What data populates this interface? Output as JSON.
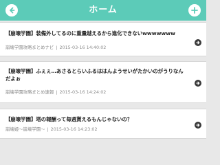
{
  "header": {
    "title": "ホーム",
    "back_icon": "arrow-left-icon",
    "add_icon": "plus-icon",
    "accent_color": "#5ccbb8"
  },
  "items": [
    {
      "title": "【崩壊学園】装備外してるのに重量越えるから進化できないwwwwwww",
      "source": "崩壊学園攻略まとめナビ",
      "separator": "|",
      "date": "2015-03-16 14:40:02"
    },
    {
      "title": "【崩壊学園】ふぇぇ…あさるとらいふるははんようせいがたかいのがうりなんだよぉ",
      "source": "崩壊学園攻略まとめ速報",
      "separator": "|",
      "date": "2015-03-16 14:24:02"
    },
    {
      "title": "【崩壊学園】塔の報酬って毎週貰えるもんじゃないの？",
      "source": "崩壊姫～崩壊学園～",
      "separator": "|",
      "date": "2015-03-16 14:23:02"
    }
  ]
}
